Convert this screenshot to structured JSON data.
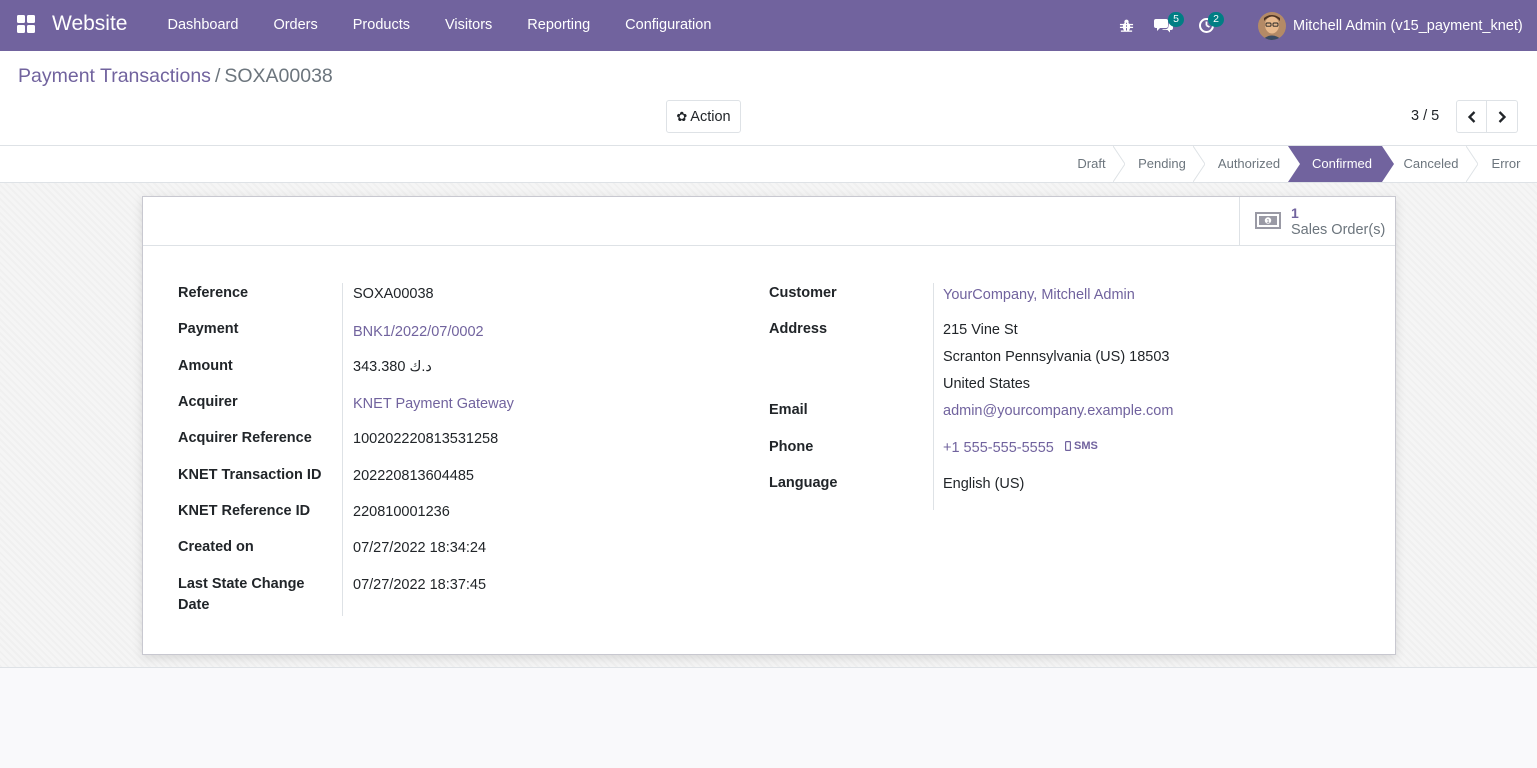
{
  "navbar": {
    "app_name": "Website",
    "menu": [
      "Dashboard",
      "Orders",
      "Products",
      "Visitors",
      "Reporting",
      "Configuration"
    ],
    "messages_count": "5",
    "activities_count": "2",
    "user": "Mitchell Admin (v15_payment_knet)",
    "bg_color": "#71639e"
  },
  "breadcrumb": {
    "parent": "Payment Transactions",
    "separator": "/",
    "current": "SOXA00038"
  },
  "control": {
    "action_label": "Action",
    "pager": "3 / 5"
  },
  "statusbar": {
    "states": [
      "Draft",
      "Pending",
      "Authorized",
      "Confirmed",
      "Canceled",
      "Error"
    ],
    "active": "Confirmed"
  },
  "smart_button": {
    "count": "1",
    "label": "Sales Order(s)"
  },
  "left_fields": [
    {
      "label": "Reference",
      "value": "SOXA00038"
    },
    {
      "label": "Payment",
      "value": "BNK1/2022/07/0002"
    },
    {
      "label": "Amount",
      "value": "343.380  د.ك"
    },
    {
      "label": "Acquirer",
      "value": "KNET Payment Gateway"
    },
    {
      "label": "Acquirer Reference",
      "value": "100202220813531258"
    },
    {
      "label": "KNET Transaction ID",
      "value": "202220813604485"
    },
    {
      "label": "KNET Reference ID",
      "value": "220810001236"
    },
    {
      "label": "Created on",
      "value": "07/27/2022 18:34:24"
    },
    {
      "label": "Last State Change Date",
      "value": "07/27/2022 18:37:45"
    }
  ],
  "right_fields": {
    "customer_label": "Customer",
    "customer": "YourCompany, Mitchell Admin",
    "address_label": "Address",
    "address_line1": "215 Vine St",
    "address_line2": "Scranton  Pennsylvania (US)  18503",
    "address_line3": "United States",
    "email_label": "Email",
    "email": "admin@yourcompany.example.com",
    "phone_label": "Phone",
    "phone": "+1 555-555-5555",
    "sms_label": "SMS",
    "language_label": "Language",
    "language": "English (US)"
  }
}
